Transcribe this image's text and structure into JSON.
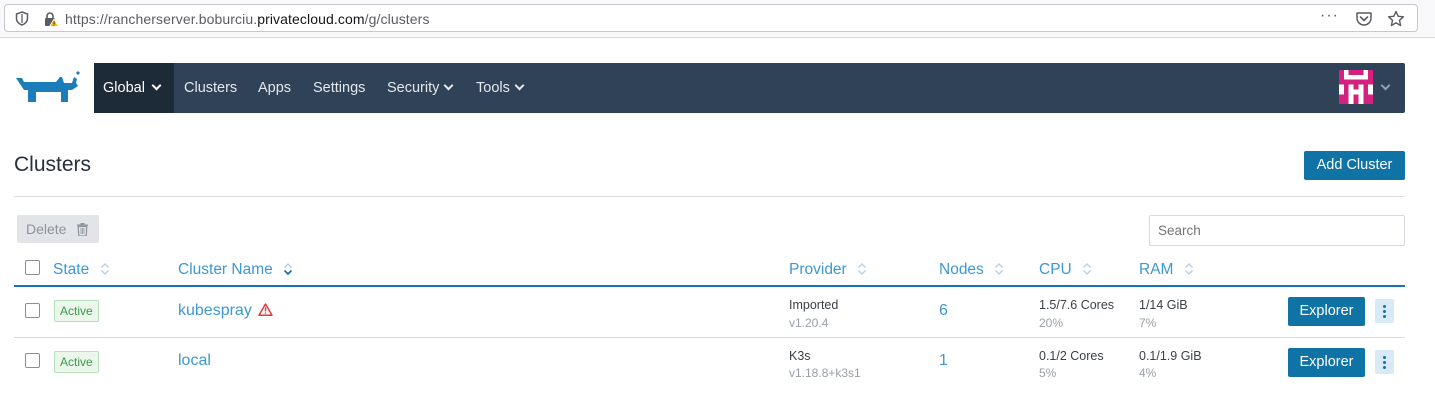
{
  "browser": {
    "url_prefix": "https://rancherserver.boburciu.",
    "url_host": "privatecloud.com",
    "url_path": "/g/clusters",
    "menu_dots": "···"
  },
  "nav": {
    "items": [
      {
        "label": "Global"
      },
      {
        "label": "Clusters"
      },
      {
        "label": "Apps"
      },
      {
        "label": "Settings"
      },
      {
        "label": "Security"
      },
      {
        "label": "Tools"
      }
    ]
  },
  "page": {
    "title": "Clusters",
    "add_cluster_label": "Add Cluster",
    "delete_label": "Delete",
    "search_placeholder": "Search"
  },
  "table": {
    "headers": {
      "state": "State",
      "cluster_name": "Cluster Name",
      "provider": "Provider",
      "nodes": "Nodes",
      "cpu": "CPU",
      "ram": "RAM"
    },
    "rows": [
      {
        "state": "Active",
        "name": "kubespray",
        "warning": true,
        "provider": "Imported",
        "provider_version": "v1.20.4",
        "nodes": "6",
        "cpu": "1.5/7.6 Cores",
        "cpu_pct": "20%",
        "ram": "1/14 GiB",
        "ram_pct": "7%",
        "action": "Explorer"
      },
      {
        "state": "Active",
        "name": "local",
        "warning": false,
        "provider": "K3s",
        "provider_version": "v1.18.8+k3s1",
        "nodes": "1",
        "cpu": "0.1/2 Cores",
        "cpu_pct": "5%",
        "ram": "0.1/1.9 GiB",
        "ram_pct": "4%",
        "action": "Explorer"
      }
    ]
  },
  "colors": {
    "nav_bg": "#2f4257",
    "nav_active_bg": "#1d2a38",
    "primary": "#1073a6",
    "link": "#3d98d3",
    "active_badge": "#3a9a4a",
    "warning": "#e0383e",
    "avatar": "#d4217f"
  }
}
